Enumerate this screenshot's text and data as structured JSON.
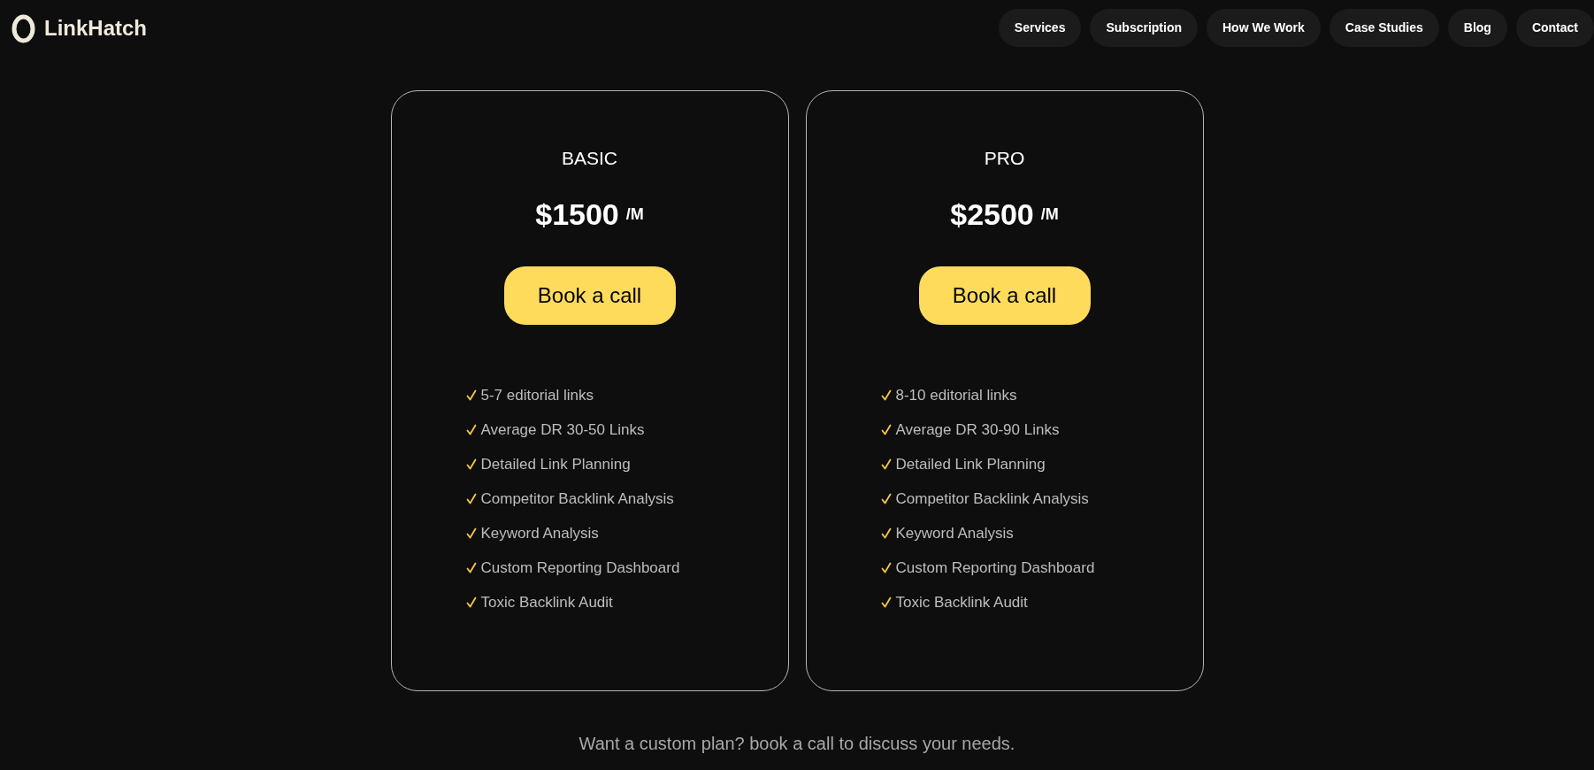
{
  "header": {
    "logo": "LinkHatch",
    "nav": [
      "Services",
      "Subscription",
      "How We Work",
      "Case Studies",
      "Blog",
      "Contact"
    ]
  },
  "plans": [
    {
      "name": "BASIC",
      "price": "$1500",
      "period": "/M",
      "button": "Book a call",
      "features": [
        "5-7 editorial links",
        "Average DR 30-50 Links",
        "Detailed Link Planning",
        "Competitor Backlink Analysis",
        "Keyword Analysis",
        "Custom Reporting Dashboard",
        "Toxic Backlink Audit"
      ]
    },
    {
      "name": "PRO",
      "price": "$2500",
      "period": "/M",
      "button": "Book a call",
      "features": [
        "8-10 editorial links",
        "Average DR 30-90 Links",
        "Detailed Link Planning",
        "Competitor Backlink Analysis",
        "Keyword Analysis",
        "Custom Reporting Dashboard",
        "Toxic Backlink Audit"
      ]
    }
  ],
  "footer_note": "Want a custom plan? book a call to discuss your needs."
}
